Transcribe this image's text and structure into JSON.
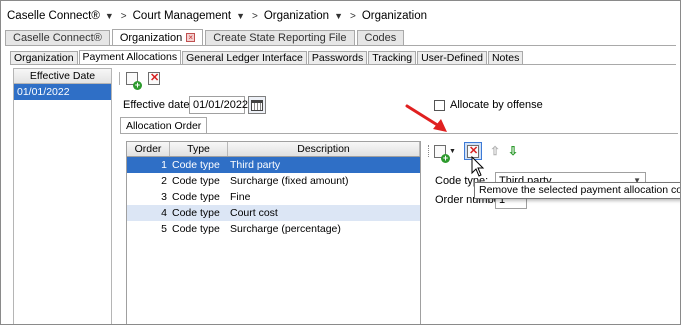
{
  "breadcrumb": {
    "items": [
      "Caselle Connect®",
      "Court Management",
      "Organization",
      "Organization"
    ]
  },
  "outer_tabs": [
    "Caselle Connect®",
    "Organization",
    "Create State Reporting File",
    "Codes"
  ],
  "inner_tabs": [
    "Organization",
    "Payment Allocations",
    "General Ledger Interface",
    "Passwords",
    "Tracking",
    "User-Defined",
    "Notes"
  ],
  "left_panel": {
    "header": "Effective Date",
    "rows": [
      "01/01/2022"
    ]
  },
  "form": {
    "effective_date_label": "Effective date:",
    "effective_date_value": "01/01/2022",
    "allocate_by_offense_label": "Allocate by offense",
    "allocation_tab": "Allocation Order"
  },
  "grid": {
    "headers": {
      "order": "Order",
      "type": "Type",
      "description": "Description"
    },
    "rows": [
      {
        "order": "1",
        "type": "Code type",
        "description": "Third party"
      },
      {
        "order": "2",
        "type": "Code type",
        "description": "Surcharge (fixed amount)"
      },
      {
        "order": "3",
        "type": "Code type",
        "description": "Fine"
      },
      {
        "order": "4",
        "type": "Code type",
        "description": "Court cost"
      },
      {
        "order": "5",
        "type": "Code type",
        "description": "Surcharge (percentage)"
      }
    ]
  },
  "detail": {
    "code_type_label": "Code type:",
    "code_type_value": "Third party",
    "order_number_label": "Order number:",
    "order_number_value": "1"
  },
  "tooltip": "Remove the selected payment allocation code",
  "colors": {
    "selection": "#2f6fc6",
    "alt_row": "#dce6f5",
    "annotation_arrow": "#e02020"
  },
  "icons": [
    "add-icon",
    "delete-icon",
    "calendar-icon",
    "move-up-icon",
    "move-down-icon",
    "tab-close-icon",
    "mouse-cursor-icon"
  ]
}
